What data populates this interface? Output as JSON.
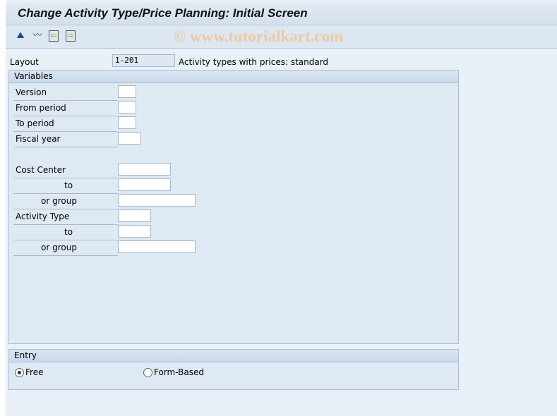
{
  "title": "Change Activity Type/Price Planning: Initial Screen",
  "watermark": "© www.tutorialkart.com",
  "toolbar": {
    "icons": [
      "person-icon",
      "chart-icon",
      "previous-icon",
      "next-icon"
    ],
    "glyphs": [
      "⛰",
      "〰",
      "⇦",
      "⇨"
    ]
  },
  "layout": {
    "label": "Layout",
    "value": "1-201",
    "description": "Activity types with prices: standard"
  },
  "variables": {
    "title": "Variables",
    "rows": [
      {
        "label": "Version",
        "value": ""
      },
      {
        "label": "From period",
        "value": ""
      },
      {
        "label": "To period",
        "value": ""
      },
      {
        "label": "Fiscal year",
        "value": ""
      },
      {
        "label": "Cost Center",
        "value": ""
      },
      {
        "label": "to",
        "value": ""
      },
      {
        "label": "or group",
        "value": ""
      },
      {
        "label": "Activity Type",
        "value": ""
      },
      {
        "label": "to",
        "value": ""
      },
      {
        "label": "or group",
        "value": ""
      }
    ]
  },
  "entry": {
    "title": "Entry",
    "options": [
      {
        "label": "Free",
        "selected": true
      },
      {
        "label": "Form-Based",
        "selected": false
      }
    ]
  }
}
